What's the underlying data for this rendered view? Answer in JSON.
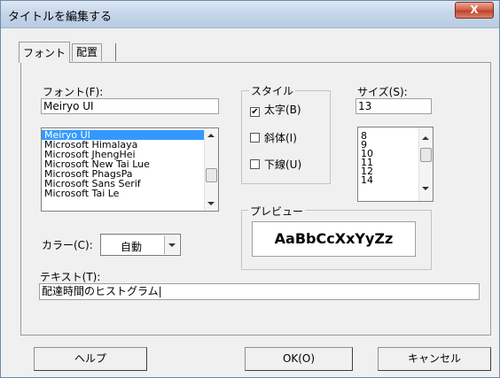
{
  "window": {
    "title": "タイトルを編集する",
    "close_label": "X"
  },
  "tabs": [
    {
      "label": "フォント"
    },
    {
      "label": "配置"
    }
  ],
  "font": {
    "label": "フォント(F):",
    "value": "Meiryo UI",
    "list": [
      "Meiryo UI",
      "Microsoft Himalaya",
      "Microsoft JhengHei",
      "Microsoft New Tai Lue",
      "Microsoft PhagsPa",
      "Microsoft Sans Serif",
      "Microsoft Tai Le"
    ],
    "selected": "Meiryo UI"
  },
  "style": {
    "group_title": "スタイル",
    "bold_label": "太字(B)",
    "bold_checked": true,
    "italic_label": "斜体(I)",
    "italic_checked": false,
    "underline_label": "下線(U)",
    "underline_checked": false,
    "check_mark": "✔"
  },
  "size": {
    "label": "サイズ(S):",
    "value": "13",
    "list": [
      "8",
      "9",
      "10",
      "11",
      "12",
      "14"
    ]
  },
  "preview": {
    "group_title": "プレビュー",
    "sample_text": "AaBbCcXxYyZz"
  },
  "color": {
    "label": "カラー(C):",
    "value": "自動"
  },
  "text": {
    "label": "テキスト(T):",
    "value": "配達時間のヒストグラム|"
  },
  "buttons": {
    "help": "ヘルプ",
    "ok": "OK(O)",
    "cancel": "キャンセル"
  },
  "colors": {
    "selection": "#3399ff",
    "close": "#c3412a",
    "titlebar": "#c6d6ea"
  }
}
